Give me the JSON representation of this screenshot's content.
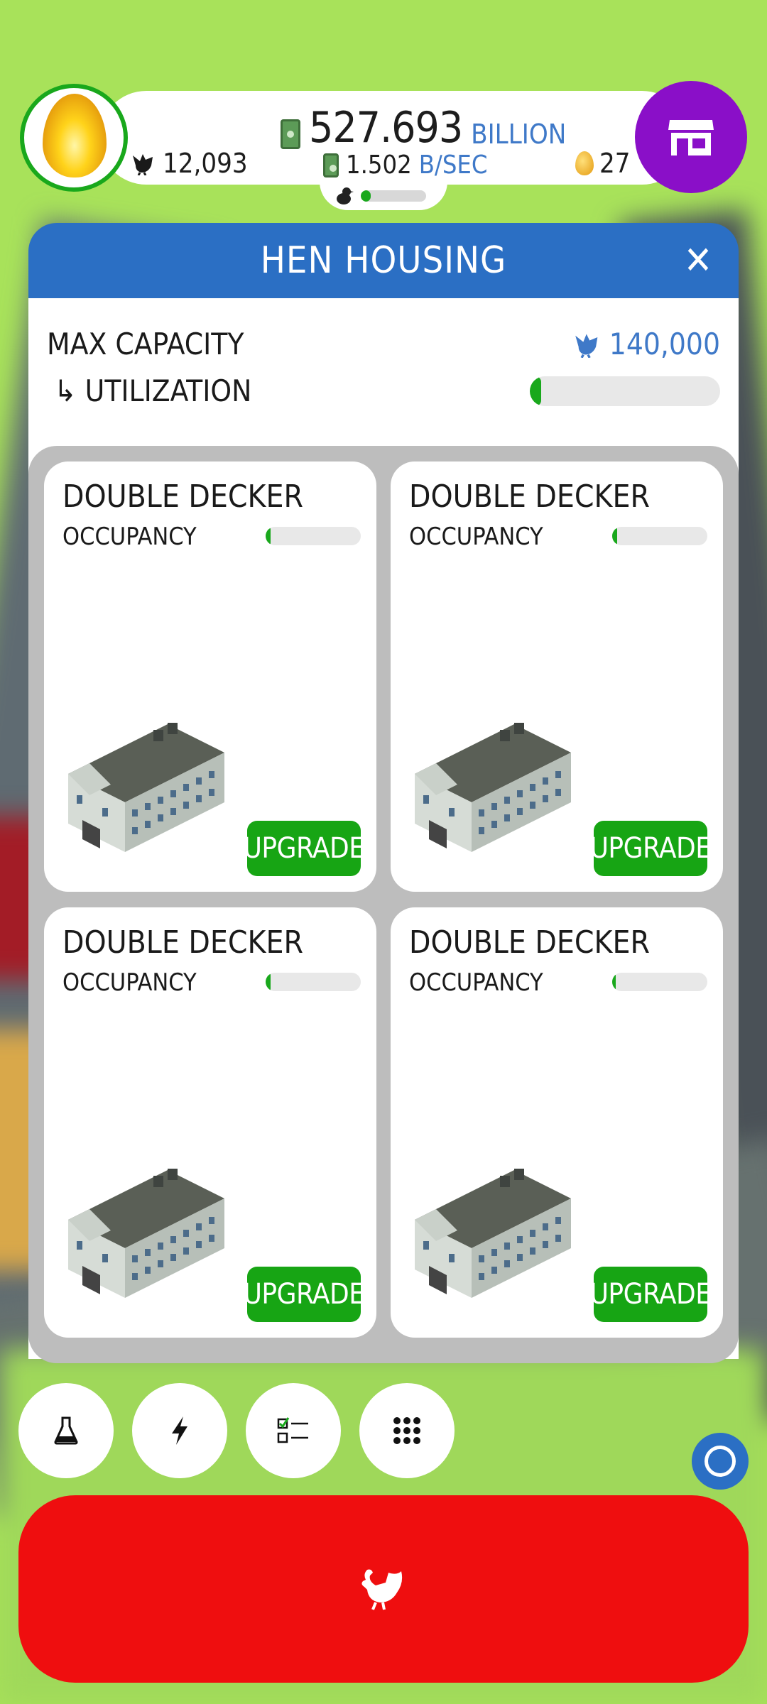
{
  "hud": {
    "money_value": "527.693",
    "money_unit": "BILLION",
    "rate_value": "1.502",
    "rate_unit": "B/SEC",
    "chicken_count": "12,093",
    "golden_eggs": "27",
    "hatch_progress_fraction": 0.15
  },
  "modal": {
    "title": "HEN HOUSING",
    "max_capacity_label": "MAX CAPACITY",
    "utilization_label": "↳ UTILIZATION",
    "max_capacity_value": "140,000",
    "utilization_fraction": 0.06
  },
  "houses": [
    {
      "name": "DOUBLE DECKER",
      "occupancy_label": "OCCUPANCY",
      "occupancy_fraction": 0.05,
      "upgrade_label": "UPGRADE"
    },
    {
      "name": "DOUBLE DECKER",
      "occupancy_label": "OCCUPANCY",
      "occupancy_fraction": 0.05,
      "upgrade_label": "UPGRADE"
    },
    {
      "name": "DOUBLE DECKER",
      "occupancy_label": "OCCUPANCY",
      "occupancy_fraction": 0.05,
      "upgrade_label": "UPGRADE"
    },
    {
      "name": "DOUBLE DECKER",
      "occupancy_label": "OCCUPANCY",
      "occupancy_fraction": 0.04,
      "upgrade_label": "UPGRADE"
    }
  ],
  "toolbar": {
    "icons": [
      "flask-icon",
      "lightning-icon",
      "checklist-icon",
      "grid-menu-icon"
    ]
  },
  "colors": {
    "header_blue": "#2b6fc4",
    "progress_green": "#19a81c",
    "upgrade_green": "#17a514",
    "shop_purple": "#8a0fc8",
    "hatch_red": "#ef0e0f",
    "accent_blue_text": "#3f79c8"
  }
}
